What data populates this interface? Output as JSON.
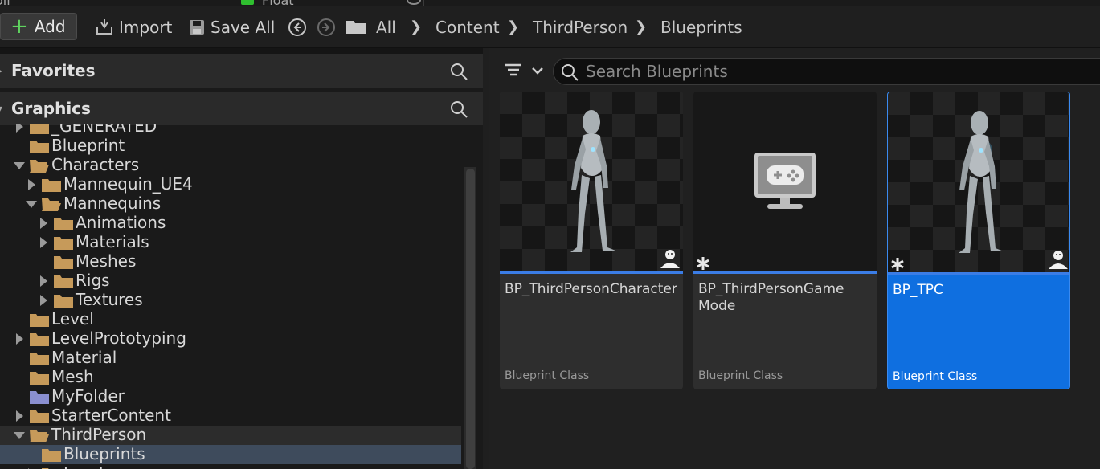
{
  "top_strip": {
    "left_text": "oll",
    "type_text": "Float"
  },
  "toolbar": {
    "add_label": "Add",
    "import_label": "Import",
    "save_all_label": "Save All"
  },
  "breadcrumb": [
    "All",
    "Content",
    "ThirdPerson",
    "Blueprints"
  ],
  "panels": {
    "favorites_label": "Favorites",
    "graphics_label": "Graphics"
  },
  "tree": [
    {
      "label": "_GENERATED",
      "level": 1,
      "expander": "right",
      "color": "tan"
    },
    {
      "label": "Blueprint",
      "level": 1,
      "expander": "none",
      "color": "tan"
    },
    {
      "label": "Characters",
      "level": 1,
      "expander": "down",
      "color": "tan",
      "open": true
    },
    {
      "label": "Mannequin_UE4",
      "level": 2,
      "expander": "right",
      "color": "tan"
    },
    {
      "label": "Mannequins",
      "level": 2,
      "expander": "down",
      "color": "tan",
      "open": true
    },
    {
      "label": "Animations",
      "level": 3,
      "expander": "right",
      "color": "tan"
    },
    {
      "label": "Materials",
      "level": 3,
      "expander": "right",
      "color": "tan"
    },
    {
      "label": "Meshes",
      "level": 3,
      "expander": "none",
      "color": "tan"
    },
    {
      "label": "Rigs",
      "level": 3,
      "expander": "right",
      "color": "tan"
    },
    {
      "label": "Textures",
      "level": 3,
      "expander": "right",
      "color": "tan"
    },
    {
      "label": "Level",
      "level": 1,
      "expander": "none",
      "color": "tan"
    },
    {
      "label": "LevelPrototyping",
      "level": 1,
      "expander": "right",
      "color": "tan"
    },
    {
      "label": "Material",
      "level": 1,
      "expander": "none",
      "color": "tan"
    },
    {
      "label": "Mesh",
      "level": 1,
      "expander": "none",
      "color": "tan"
    },
    {
      "label": "MyFolder",
      "level": 1,
      "expander": "none",
      "color": "purple"
    },
    {
      "label": "StarterContent",
      "level": 1,
      "expander": "right",
      "color": "tan"
    },
    {
      "label": "ThirdPerson",
      "level": 1,
      "expander": "down",
      "color": "tan",
      "open": true,
      "state": "parent"
    },
    {
      "label": "Blueprints",
      "level": 2,
      "expander": "none",
      "color": "tan",
      "state": "selected"
    },
    {
      "label": "Input",
      "level": 2,
      "expander": "right",
      "color": "tan"
    }
  ],
  "search": {
    "placeholder": "Search Blueprints"
  },
  "assets": [
    {
      "name": "BP_ThirdPersonCharacter",
      "class_label": "Blueprint Class",
      "thumb": "mannequin",
      "selected": false,
      "star": false,
      "pawn": true
    },
    {
      "name": "BP_ThirdPersonGame\nMode",
      "class_label": "Blueprint Class",
      "thumb": "gamemode",
      "selected": false,
      "star": true,
      "pawn": false
    },
    {
      "name": "BP_TPC",
      "class_label": "Blueprint Class",
      "thumb": "mannequin",
      "selected": true,
      "star": true,
      "pawn": true
    }
  ],
  "colors": {
    "accent": "#0f6fe0",
    "folder_tan": "#c69a5a",
    "folder_purple": "#8a8fd0",
    "add_plus": "#5fd35f",
    "selection_row": "#3e4b5c"
  }
}
